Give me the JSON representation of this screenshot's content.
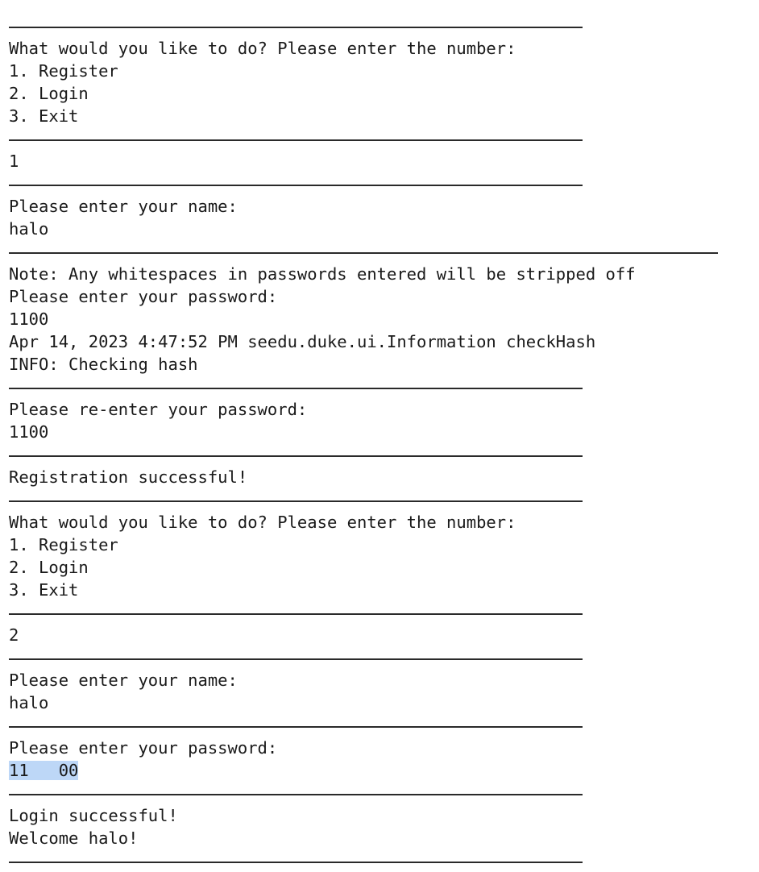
{
  "menu_prompt": "What would you like to do? Please enter the number:",
  "menu_options": [
    "1. Register",
    "2. Login",
    "3. Exit"
  ],
  "session": {
    "choice_1": "1",
    "name_prompt_1": "Please enter your name:",
    "name_1": "halo",
    "note": "Note: Any whitespaces in passwords entered will be stripped off",
    "password_prompt_1": "Please enter your password:",
    "password_1": "1100",
    "log_line": "Apr 14, 2023 4:47:52 PM seedu.duke.ui.Information checkHash",
    "log_info": "INFO: Checking hash",
    "reenter_prompt": "Please re-enter your password:",
    "reenter_value": "1100",
    "registration_result": "Registration successful!",
    "choice_2": "2",
    "name_prompt_2": "Please enter your name:",
    "name_2": "halo",
    "password_prompt_2": "Please enter your password:",
    "password_2": "11   00",
    "login_result": "Login successful!",
    "welcome": "Welcome halo!"
  },
  "colors": {
    "text": "#1a1a1a",
    "separator": "#2a2a2a",
    "selection": "#bdd7f7"
  }
}
